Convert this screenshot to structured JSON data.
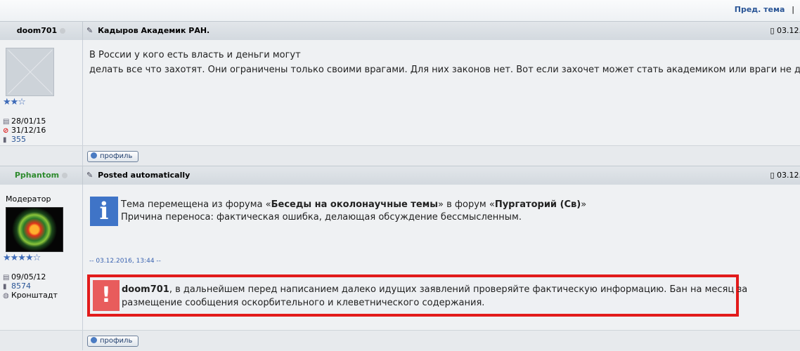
{
  "nav": {
    "prev_topic": "Пред. тема",
    "separator": "|"
  },
  "posts": [
    {
      "author": "doom701",
      "subject": "Кадыров Академик РАН.",
      "date": "03.12.",
      "stars": "★★☆",
      "stats": {
        "reg": "28/01/15",
        "ban": "31/12/16",
        "posts": "355"
      },
      "body_lines": [
        "В России у кого есть власть и деньги могут",
        "делать все что захотят. Они ограничены только своими врагами. Для них законов нет. Вот если захочет может стать академиком или враги не дадут?"
      ],
      "profile_label": "профиль"
    },
    {
      "author": "Pphantom",
      "author_color": "#2e8b2e",
      "subject": "Posted automatically",
      "date": "03.12.",
      "role": "Модератор",
      "stars": "★★★★☆",
      "stats": {
        "reg": "09/05/12",
        "posts": "8574",
        "location": "Кронштадт"
      },
      "info": {
        "line1_pre": "Тема перемещена из форума «",
        "line1_forum_from": "Беседы на околонаучные темы",
        "line1_mid": "» в форум «",
        "line1_forum_to": "Пургаторий (Св)",
        "line1_post": "»",
        "line2": "Причина переноса: фактическая ошибка, делающая обсуждение бессмысленным."
      },
      "timestamp": "-- 03.12.2016, 13:44 --",
      "warning": {
        "user": "doom701",
        "line1": ", в дальнейшем перед написанием далеко идущих заявлений проверяйте фактическую информацию. Бан на месяц за",
        "line2": "размещение сообщения оскорбительного и клеветнического содержания."
      },
      "profile_label": "профиль"
    }
  ],
  "colors": {
    "link": "#2a5596",
    "info_bg": "#3f74c7",
    "warn_border": "#e21b1b",
    "warn_bg": "#e85c5c"
  }
}
